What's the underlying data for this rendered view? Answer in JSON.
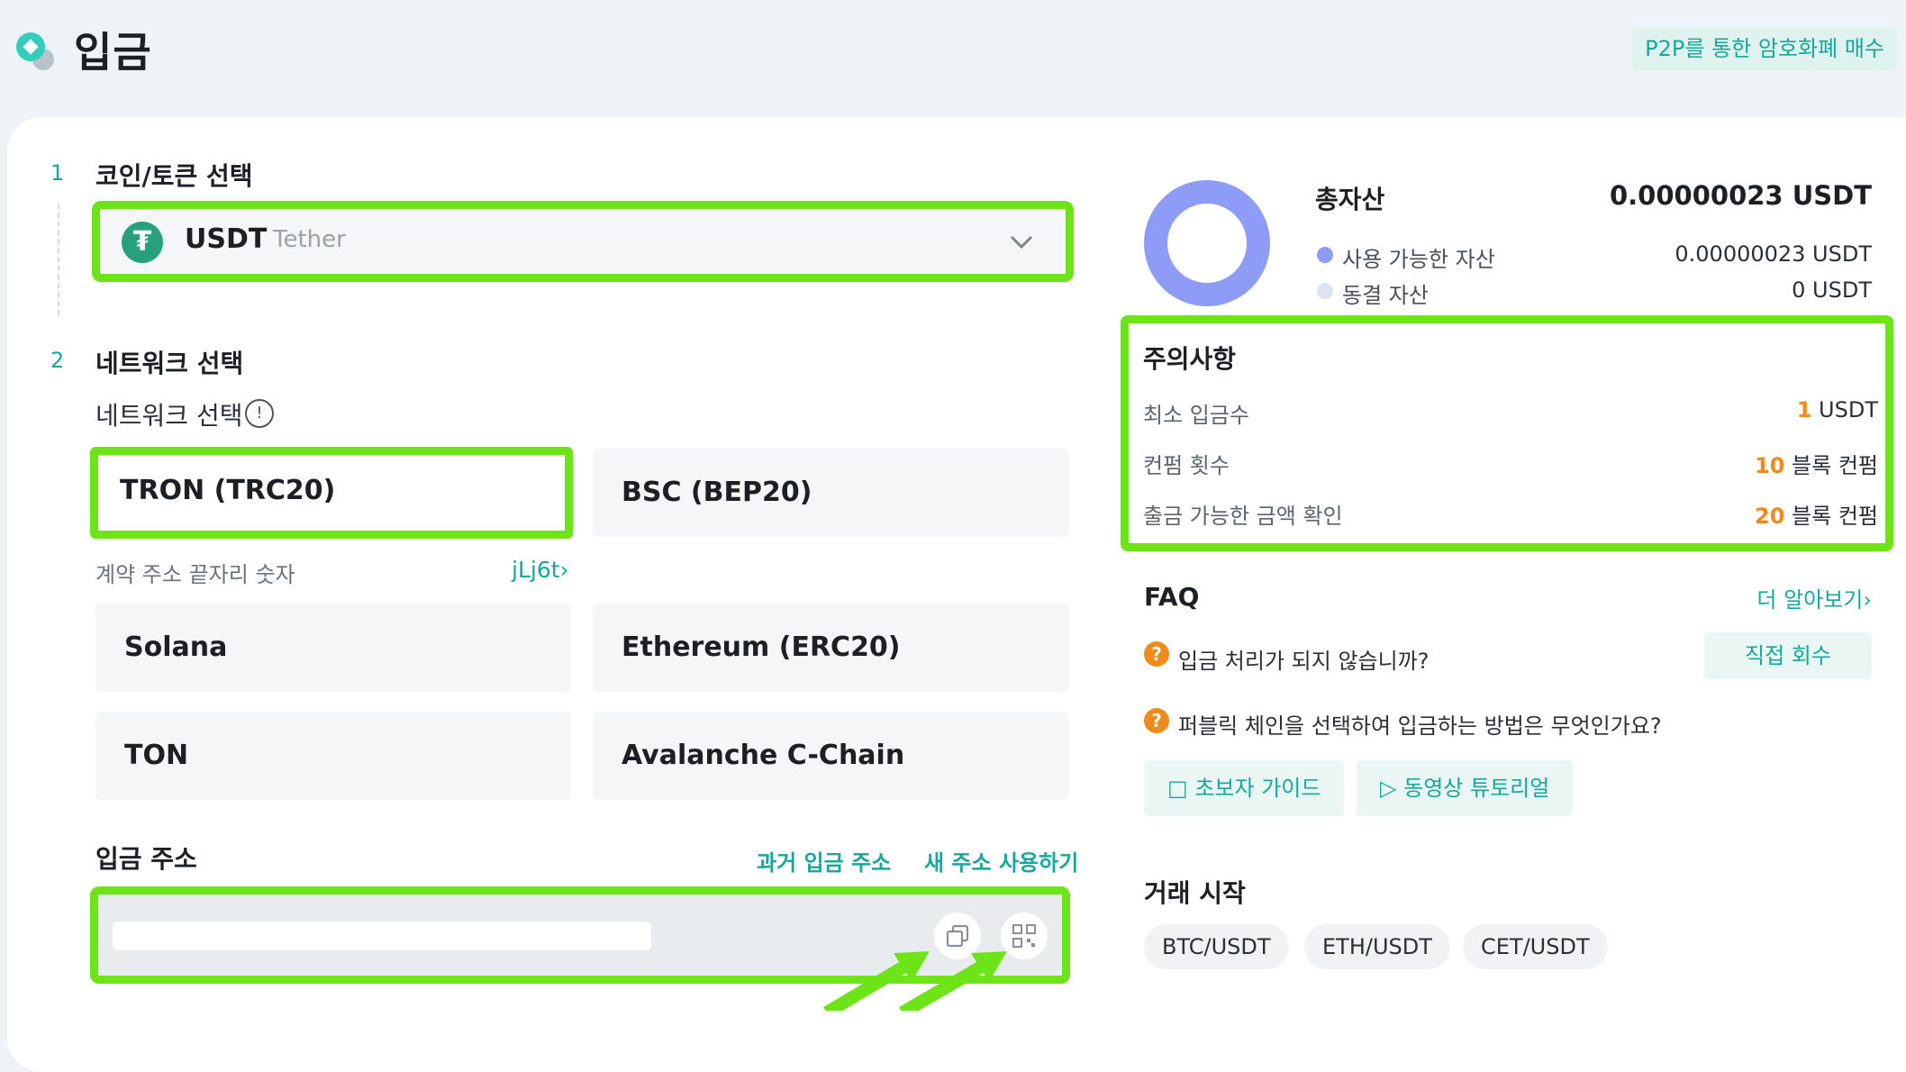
{
  "page": {
    "title": "입금",
    "p2p_button": "P2P를 통한 암호화폐 매수"
  },
  "steps": [
    {
      "number": "1",
      "title": "코인/토큰 선택"
    },
    {
      "number": "2",
      "title": "네트워크 선택"
    }
  ],
  "coin": {
    "symbol": "USDT",
    "name": "Tether",
    "icon_glyph": "₮"
  },
  "network": {
    "label": "네트워크 선택",
    "options": [
      {
        "label": "TRON (TRC20)",
        "selected": true
      },
      {
        "label": "BSC (BEP20)",
        "selected": false
      },
      {
        "label": "Solana",
        "selected": false
      },
      {
        "label": "Ethereum (ERC20)",
        "selected": false
      },
      {
        "label": "TON",
        "selected": false
      },
      {
        "label": "Avalanche C-Chain",
        "selected": false
      }
    ],
    "contract_label": "계약 주소 끝자리 숫자",
    "contract_value": "jLj6t›"
  },
  "deposit_address": {
    "title": "입금 주소",
    "history_link": "과거 입금 주소",
    "new_address_link": "새 주소 사용하기",
    "value": ""
  },
  "assets": {
    "title": "총자산",
    "total": "0.00000023 USDT",
    "available_label": "사용 가능한 자산",
    "available_value": "0.00000023 USDT",
    "frozen_label": "동결 자산",
    "frozen_value": "0 USDT",
    "colors": {
      "available": "#8e9cf8",
      "frozen": "#dfe2f0"
    }
  },
  "notice": {
    "title": "주의사항",
    "rows": [
      {
        "label": "최소 입금수",
        "num": "1",
        "unit": " USDT"
      },
      {
        "label": "컨펌 횟수",
        "num": "10",
        "unit": " 블록 컨펌"
      },
      {
        "label": "출금 가능한 금액 확인",
        "num": "20",
        "unit": " 블록 컨펌"
      }
    ]
  },
  "faq": {
    "title": "FAQ",
    "more": "더 알아보기›",
    "q1": "입금 처리가 되지 않습니까?",
    "recover_button": "직접 회수",
    "q2": "퍼블릭 체인을 선택하여 입금하는 방법은 무엇인가요?",
    "beginner_guide": "초보자 가이드",
    "video_tutorial": "동영상 튜토리얼"
  },
  "trade": {
    "title": "거래 시작",
    "pairs": [
      "BTC/USDT",
      "ETH/USDT",
      "CET/USDT"
    ]
  },
  "theme": {
    "accent": "#15a89b",
    "highlight_border": "#6de418",
    "warning": "#f08a1b"
  }
}
